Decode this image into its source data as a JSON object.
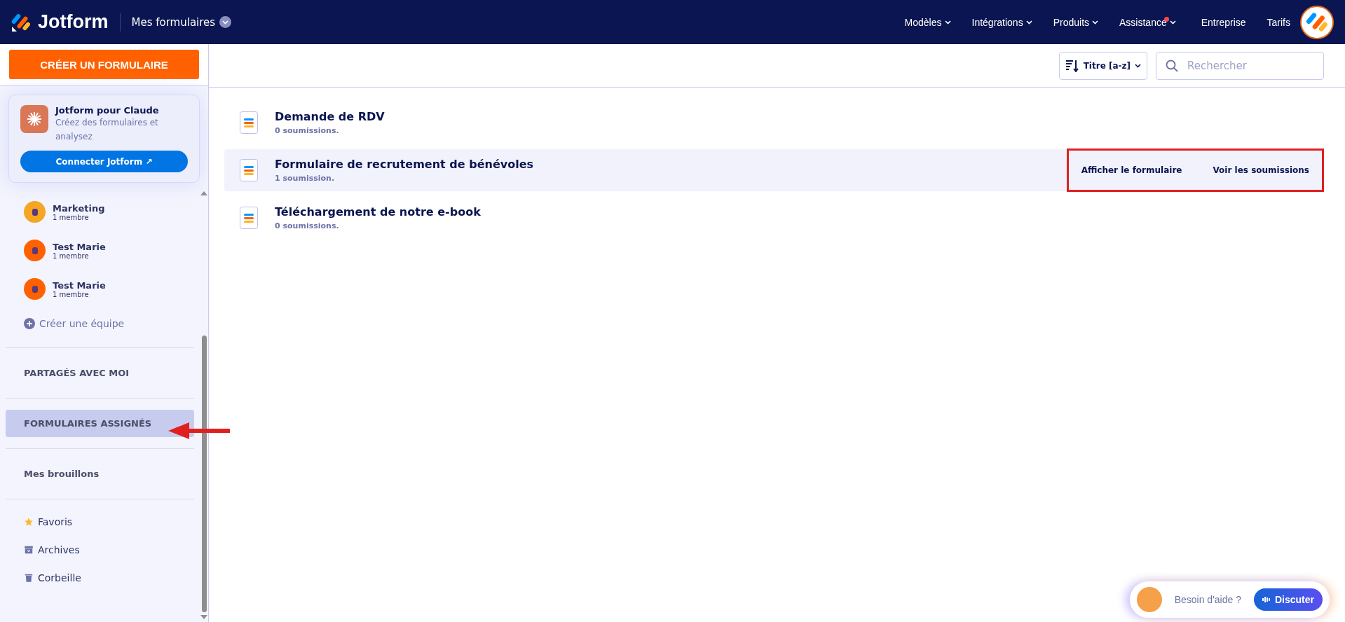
{
  "header": {
    "brand": "Jotform",
    "section": "Mes formulaires",
    "nav": [
      {
        "label": "Modèles",
        "caret": true,
        "notification": false
      },
      {
        "label": "Intégrations",
        "caret": true,
        "notification": false
      },
      {
        "label": "Produits",
        "caret": true,
        "notification": false
      },
      {
        "label": "Assistance",
        "caret": true,
        "notification": true
      },
      {
        "label": "Entreprise",
        "caret": false,
        "notification": false
      },
      {
        "label": "Tarifs",
        "caret": false,
        "notification": false
      }
    ]
  },
  "sidebar": {
    "create_button": "CRÉER UN FORMULAIRE",
    "promo": {
      "title": "Jotform pour Claude",
      "text": "Créez des formulaires et analysez",
      "button": "Connecter Jotform ↗"
    },
    "teams": [
      {
        "name": "Marketing",
        "members": "1 membre",
        "color": "#f5a623"
      },
      {
        "name": "Test Marie",
        "members": "1 membre",
        "color": "#ff6100"
      },
      {
        "name": "Test Marie",
        "members": "1 membre",
        "color": "#ff6100"
      }
    ],
    "create_team": "Créer une équipe",
    "sections": [
      {
        "label": "PARTAGÉS AVEC MOI",
        "selected": false
      },
      {
        "label": "FORMULAIRES ASSIGNÉS",
        "selected": true
      },
      {
        "label": "Mes brouillons",
        "selected": false
      }
    ],
    "folders": [
      {
        "label": "Favoris",
        "kind": "star"
      },
      {
        "label": "Archives",
        "kind": "archive"
      },
      {
        "label": "Corbeille",
        "kind": "trash"
      }
    ]
  },
  "toolbar": {
    "sort": "Titre [a-z]",
    "search": {
      "placeholder": "Rechercher"
    }
  },
  "forms": [
    {
      "title": "Demande de RDV",
      "submissions": "0 soumissions.",
      "hovered": false
    },
    {
      "title": "Formulaire de recrutement de bénévoles",
      "submissions": "1 soumission.",
      "hovered": true,
      "actions": [
        "Afficher le formulaire",
        "Voir les soumissions"
      ]
    },
    {
      "title": "Téléchargement de notre e-book",
      "submissions": "0 soumissions.",
      "hovered": false
    }
  ],
  "help": {
    "text": "Besoin d'aide ?",
    "button": "Discuter"
  }
}
